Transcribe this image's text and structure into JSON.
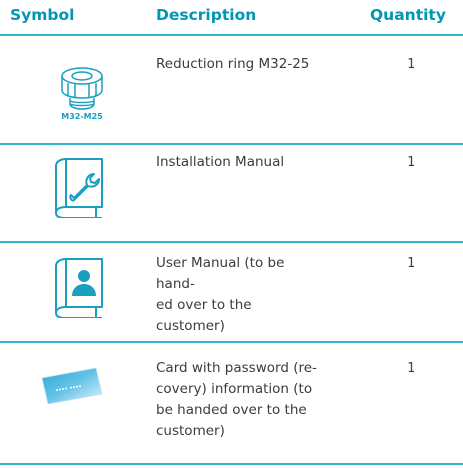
{
  "header": {
    "symbol": "Symbol",
    "description": "Description",
    "quantity": "Quantity"
  },
  "rows": [
    {
      "icon": "reduction-ring-icon",
      "icon_label": "M32-M25",
      "description_lines": [
        "Reduction ring M32-25"
      ],
      "quantity": "1"
    },
    {
      "icon": "installation-manual-icon",
      "description_lines": [
        "Installation Manual"
      ],
      "quantity": "1"
    },
    {
      "icon": "user-manual-icon",
      "description_lines": [
        "User Manual (to be hand-",
        "ed over to the customer)"
      ],
      "quantity": "1"
    },
    {
      "icon": "password-card-icon",
      "description_lines": [
        "Card with password (re-",
        "covery) information (to",
        "be handed over to the",
        "customer)"
      ],
      "quantity": "1"
    }
  ],
  "colors": {
    "accent": "#0097b2",
    "divider": "#35b4cf",
    "text": "#3c3c3c"
  }
}
